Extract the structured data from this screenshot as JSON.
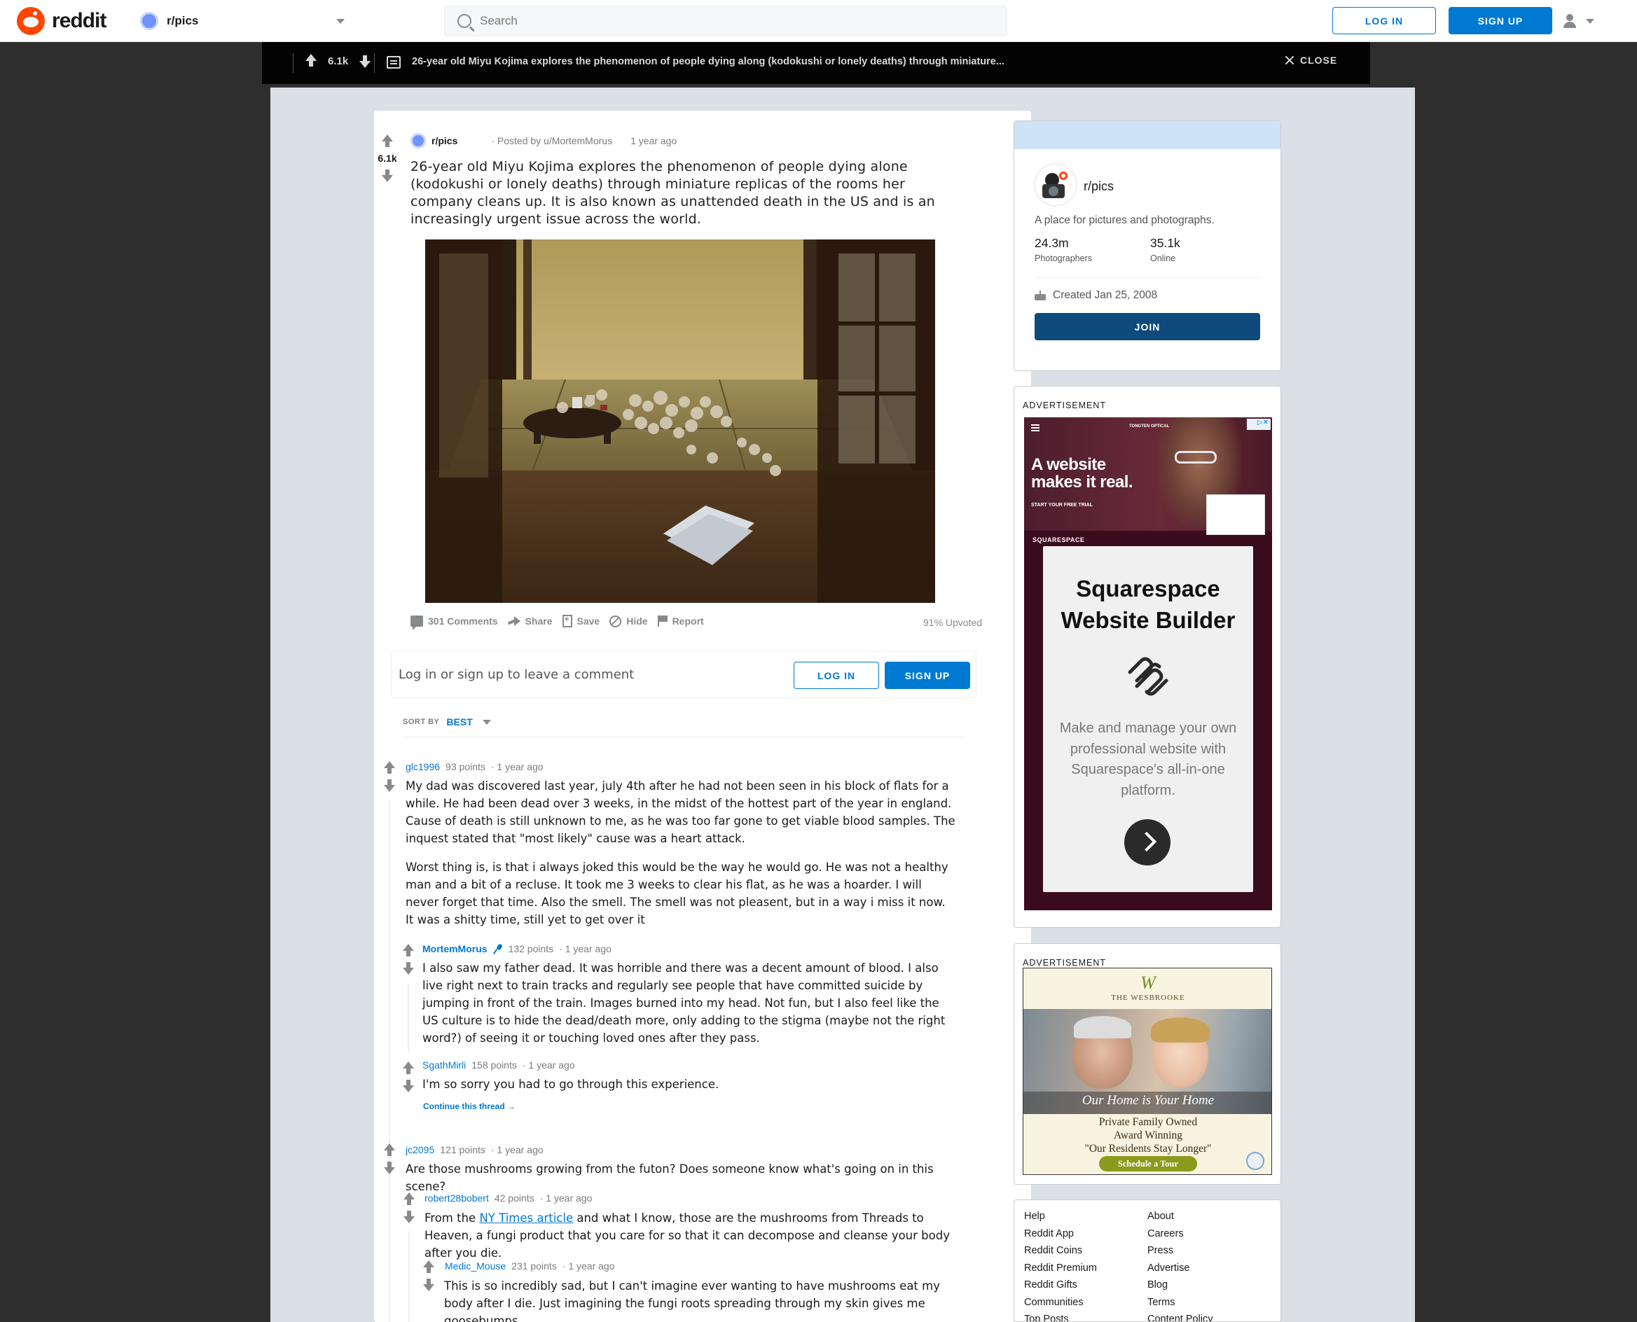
{
  "header": {
    "logo_text": "reddit",
    "community": "r/pics",
    "search_placeholder": "Search",
    "login_label": "LOG IN",
    "signup_label": "SIGN UP"
  },
  "postbar": {
    "score": "6.1k",
    "title": "26-year old Miyu Kojima explores the phenomenon of people dying along (kodokushi or lonely deaths) through miniature...",
    "close_label": "CLOSE"
  },
  "post": {
    "subreddit": "r/pics",
    "posted_by": "· Posted by u/MortemMorus",
    "time": "1 year ago",
    "score": "6.1k",
    "title": "26-year old Miyu Kojima explores the phenomenon of people dying alone (kodokushi or lonely deaths) through miniature replicas of the rooms her company cleans up. It is also known as unattended death in the US and is an increasingly urgent issue across the world.",
    "actions": {
      "comments": "301 Comments",
      "share": "Share",
      "save": "Save",
      "hide": "Hide",
      "report": "Report"
    },
    "upvoted": "91% Upvoted"
  },
  "comment_box": {
    "prompt": "Log in or sign up to leave a comment",
    "login_label": "LOG IN",
    "signup_label": "SIGN UP"
  },
  "sort": {
    "label": "SORT BY",
    "value": "BEST"
  },
  "comments": {
    "c1": {
      "author": "glc1996",
      "points": "93 points",
      "time": "· 1 year ago",
      "p1": "My dad was discovered last year, july 4th after he had not been seen in his block of flats for a while. He had been dead over 3 weeks, in the midst of the hottest part of the year in england. Cause of death is still unknown to me, as he was too far gone to get viable blood samples. The inquest stated that \"most likely\" cause was a heart attack.",
      "p2": "Worst thing is, is that i always joked this would be the way he would go. He was not a healthy man and a bit of a recluse. It took me 3 weeks to clear his flat, as he was a hoarder. I will never forget that time. Also the smell. The smell was not pleasent, but in a way i miss it now. It was a shitty time, still yet to get over it"
    },
    "c2": {
      "author": "MortemMorus",
      "points": "132 points",
      "time": "· 1 year ago",
      "body": "I also saw my father dead. It was horrible and there was a decent amount of blood. I also live right next to train tracks and regularly see people that have committed suicide by jumping in front of the train. Images burned into my head. Not fun, but I also feel like the US culture is to hide the dead/death more, only adding to the stigma (maybe not the right word?) of seeing it or touching loved ones after they pass."
    },
    "c3": {
      "author": "SgathMirli",
      "points": "158 points",
      "time": "· 1 year ago",
      "body": "I'm so sorry you had to go through this experience.",
      "continue": "Continue this thread →"
    },
    "c4": {
      "author": "jc2095",
      "points": "121 points",
      "time": "· 1 year ago",
      "body": "Are those mushrooms growing from the futon? Does someone know what's going on in this scene?"
    },
    "c5": {
      "author": "robert28bobert",
      "points": "42 points",
      "time": "· 1 year ago",
      "body_pre": "From the ",
      "link": "NY Times article",
      "body_post": " and what I know, those are the mushrooms from Threads to Heaven, a fungi product that you care for so that it can decompose and cleanse your body after you die."
    },
    "c6": {
      "author": "Medic_Mouse",
      "points": "231 points",
      "time": "· 1 year ago",
      "body": "This is so incredibly sad, but I can't imagine ever wanting to have mushrooms eat my body after I die. Just imagining the fungi roots spreading through my skin gives me goosebumps."
    }
  },
  "sidebar": {
    "name": "r/pics",
    "description": "A place for pictures and photographs.",
    "members": "24.3m",
    "members_label": "Photographers",
    "online": "35.1k",
    "online_label": "Online",
    "created": "Created Jan 25, 2008",
    "join_label": "JOIN"
  },
  "ads": {
    "label": "ADVERTISEMENT",
    "squarespace": {
      "headline": "A website makes it real.",
      "cta_small": "START YOUR FREE TRIAL",
      "top_brand": "TONGTEN OPTICAL",
      "brand": "SQUARESPACE",
      "title": "Squarespace Website Builder",
      "desc": "Make and manage your own professional website with Squarespace's all-in-one platform."
    },
    "wesbrooke": {
      "name": "THE WESBROOKE",
      "script": "Our Home is Your Home",
      "line1": "Private Family Owned",
      "line2": "Award Winning",
      "line3": "\"Our Residents Stay Longer\"",
      "button": "Schedule a Tour"
    }
  },
  "footer": {
    "col1": [
      "Help",
      "Reddit App",
      "Reddit Coins",
      "Reddit Premium",
      "Reddit Gifts",
      "Communities",
      "Top Posts"
    ],
    "col2": [
      "About",
      "Careers",
      "Press",
      "Advertise",
      "Blog",
      "Terms",
      "Content Policy"
    ]
  }
}
